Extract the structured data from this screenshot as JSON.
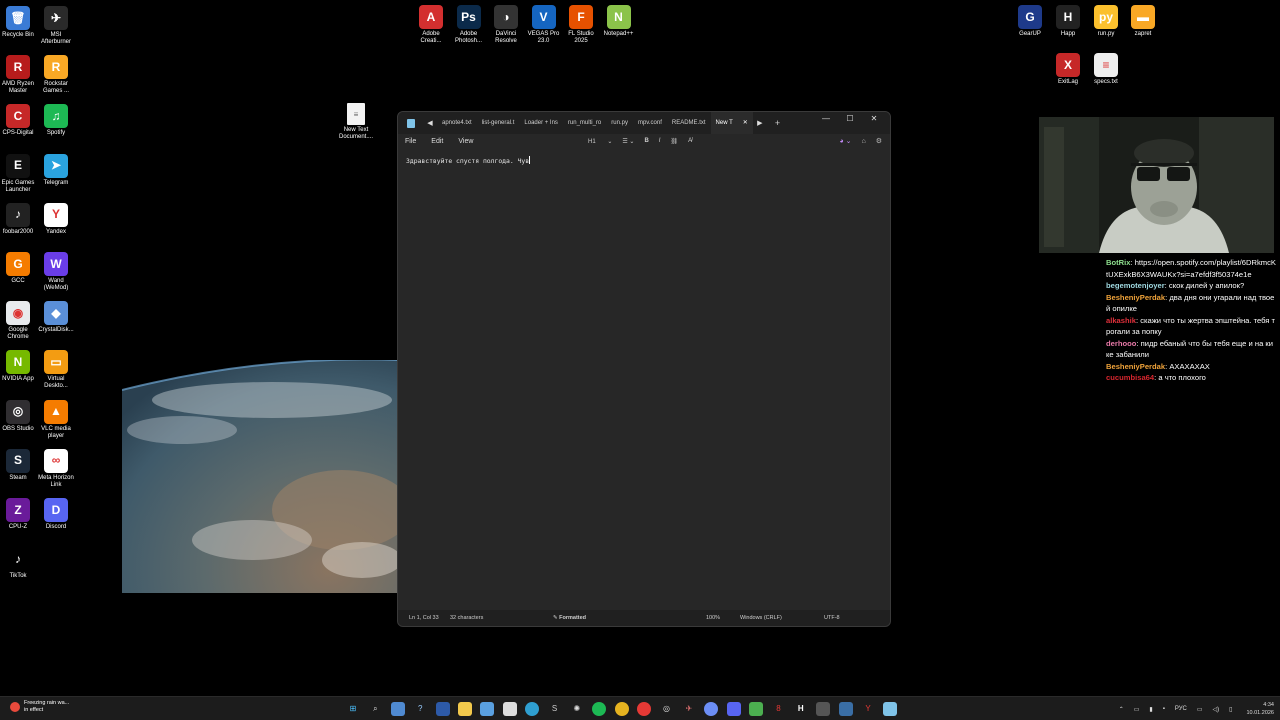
{
  "desktop": {
    "icons_left": [
      {
        "label": "Recycle Bin",
        "color": "#3a7bd5",
        "glyph": "🗑"
      },
      {
        "label": "MSI Afterburner",
        "color": "#2a2a2a",
        "glyph": "✈"
      },
      {
        "label": "AMD Ryzen Master",
        "color": "#b71c1c",
        "glyph": "R"
      },
      {
        "label": "Rockstar Games ...",
        "color": "#f9a825",
        "glyph": "R"
      },
      {
        "label": "CPS-Digital",
        "color": "#c62828",
        "glyph": "C"
      },
      {
        "label": "Spotify",
        "color": "#1db954",
        "glyph": "♫"
      },
      {
        "label": "Epic Games Launcher",
        "color": "#111",
        "glyph": "E"
      },
      {
        "label": "Telegram",
        "color": "#2aa3df",
        "glyph": "➤"
      },
      {
        "label": "foobar2000",
        "color": "#222",
        "glyph": "♪"
      },
      {
        "label": "Yandex",
        "color": "#fff",
        "glyph": "Y"
      },
      {
        "label": "GCC",
        "color": "#f57c00",
        "glyph": "G"
      },
      {
        "label": "Wand (WeMod)",
        "color": "#6a3de8",
        "glyph": "W"
      },
      {
        "label": "Google Chrome",
        "color": "#e8eaed",
        "glyph": "◉"
      },
      {
        "label": "CrystalDisk...",
        "color": "#5a8fd8",
        "glyph": "◆"
      },
      {
        "label": "NVIDIA App",
        "color": "#76b900",
        "glyph": "N"
      },
      {
        "label": "Virtual Deskto...",
        "color": "#f39c12",
        "glyph": "▭"
      },
      {
        "label": "OBS Studio",
        "color": "#302e31",
        "glyph": "◎"
      },
      {
        "label": "VLC media player",
        "color": "#f57c00",
        "glyph": "▲"
      },
      {
        "label": "Steam",
        "color": "#1b2838",
        "glyph": "S"
      },
      {
        "label": "Meta Horizon Link",
        "color": "#fff",
        "glyph": "∞"
      },
      {
        "label": "CPU-Z",
        "color": "#6a1b9a",
        "glyph": "Z"
      },
      {
        "label": "Discord",
        "color": "#5865f2",
        "glyph": "D"
      },
      {
        "label": "TikTok",
        "color": "#000",
        "glyph": "♪"
      }
    ],
    "icons_top": [
      {
        "label": "Adobe Creati...",
        "color": "#d32f2f",
        "glyph": "A"
      },
      {
        "label": "Adobe Photosh...",
        "color": "#0b2a4a",
        "glyph": "Ps"
      },
      {
        "label": "DaVinci Resolve",
        "color": "#333",
        "glyph": "◑"
      },
      {
        "label": "VEGAS Pro 23.0",
        "color": "#1565c0",
        "glyph": "V"
      },
      {
        "label": "FL Studio 2025",
        "color": "#e65100",
        "glyph": "F"
      },
      {
        "label": "Notepad++",
        "color": "#8bc34a",
        "glyph": "N"
      }
    ],
    "icons_right": [
      {
        "label": "GearUP",
        "color": "#1e3a8a",
        "glyph": "G"
      },
      {
        "label": "Happ",
        "color": "#222",
        "glyph": "H"
      },
      {
        "label": "run.py",
        "color": "#fbc02d",
        "glyph": "py"
      },
      {
        "label": "zapret",
        "color": "#f9a825",
        "glyph": "▬"
      },
      {
        "label": "ExitLag",
        "color": "#c62828",
        "glyph": "X"
      },
      {
        "label": "specs.txt",
        "color": "#eee",
        "glyph": "≡"
      }
    ],
    "new_text_doc": "New Text Document...."
  },
  "notepad": {
    "tabs": [
      "apnote4.txt",
      "list-general.t",
      "Loader + Ins",
      "run_multi_ro",
      "run.py",
      "mpv.conf",
      "README.txt",
      "New T"
    ],
    "menu": [
      "File",
      "Edit",
      "View"
    ],
    "format_heading": "H1",
    "content": "Здравствуйте спустя полгода. Чув",
    "status": {
      "position": "Ln 1, Col 33",
      "chars": "32 characters",
      "mode": "Formatted",
      "zoom": "100%",
      "line_endings": "Windows (CRLF)",
      "encoding": "UTF-8"
    }
  },
  "chat": [
    {
      "user": "BotRix",
      "color": "#8ee08e",
      "text": "https://open.spotify.com/playlist/6DRkmcKtUXExkB6X3WAUKx?si=a7efdf3f50374e1e"
    },
    {
      "user": "begemotenjoyer",
      "color": "#9fd8e0",
      "text": "скок дилей у апилок?"
    },
    {
      "user": "BesheniyPerdak",
      "color": "#f0a33a",
      "text": "два дня они угарали над твоей опилке"
    },
    {
      "user": "alkashik",
      "color": "#e0303b",
      "text": "скажи что ты жертва эпштейна. тебя трогали за попку"
    },
    {
      "user": "derhooo",
      "color": "#e879a8",
      "text": "пидр ебаный что бы тебя еще и на кике забанили"
    },
    {
      "user": "BesheniyPerdak",
      "color": "#f0a33a",
      "text": "АХАХАХАХ"
    },
    {
      "user": "cucumbisa64",
      "color": "#d7262e",
      "text": "а что плохого"
    }
  ],
  "taskbar": {
    "weather_line1": "Freezing rain wa...",
    "weather_line2": "in effect",
    "lang": "РУС",
    "time": "4:34",
    "date": "10.01.2026"
  }
}
